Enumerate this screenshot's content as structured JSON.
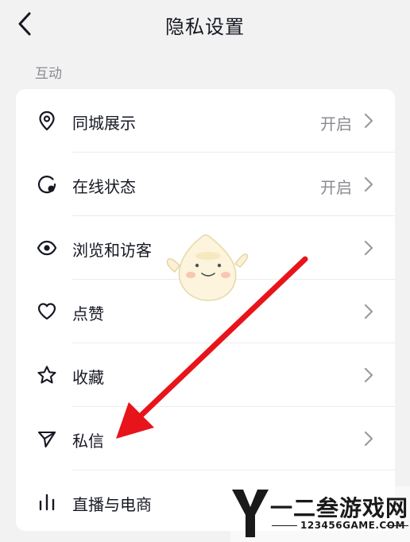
{
  "header": {
    "title": "隐私设置"
  },
  "section": {
    "label": "互动"
  },
  "rows": [
    {
      "label": "同城展示",
      "value": "开启",
      "icon": "location-pin-icon"
    },
    {
      "label": "在线状态",
      "value": "开启",
      "icon": "online-status-icon"
    },
    {
      "label": "浏览和访客",
      "value": "",
      "icon": "eye-icon"
    },
    {
      "label": "点赞",
      "value": "",
      "icon": "heart-icon"
    },
    {
      "label": "收藏",
      "value": "",
      "icon": "star-icon"
    },
    {
      "label": "私信",
      "value": "",
      "icon": "send-icon"
    },
    {
      "label": "直播与电商",
      "value": "",
      "icon": "bar-chart-icon"
    }
  ],
  "watermark": {
    "name": "一二叁游戏网",
    "url": "123456GAME.COM"
  },
  "colors": {
    "annotation_arrow": "#e8141b",
    "secondary_text": "#8a8b91"
  }
}
